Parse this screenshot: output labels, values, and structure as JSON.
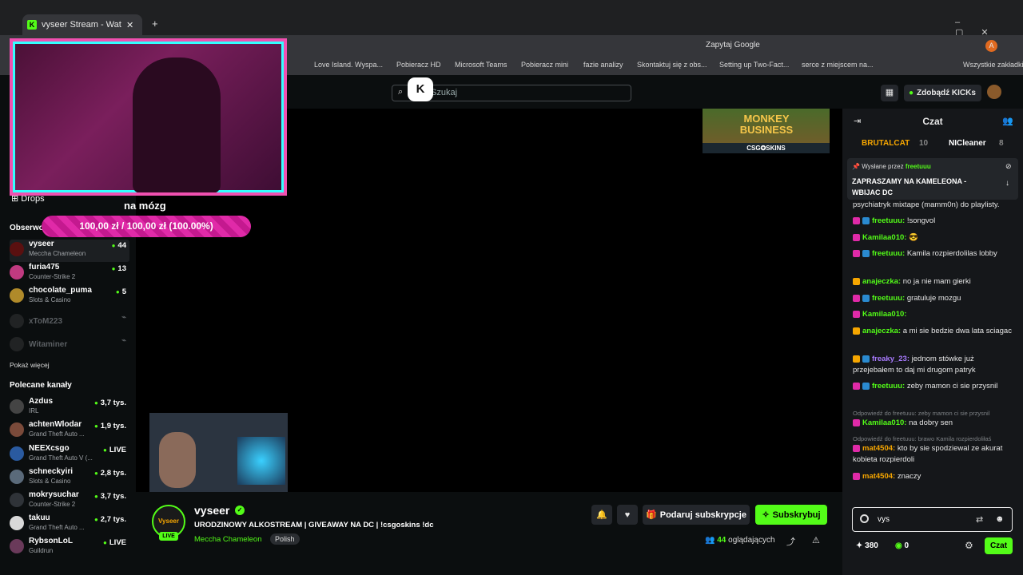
{
  "browser": {
    "tab_title": "vyseer Stream - Watch Live",
    "ask_google": "Zapytaj Google",
    "bookmarks": [
      "Love Island. Wyspa...",
      "Pobieracz HD",
      "Microsoft Teams",
      "Pobieracz mini",
      "fazie analizy",
      "Skontaktuj się z obs...",
      "Setting up Two-Fact...",
      "serce z miejscem na...",
      "Wszystkie zakładki"
    ]
  },
  "header": {
    "search_placeholder": "Szukaj",
    "get_kicks": "Zdobądź KICKs",
    "logo": "K"
  },
  "sidebar": {
    "drops_label": "Drops",
    "followed_title": "Obserwowane",
    "followed": [
      {
        "name": "vyseer",
        "category": "Meccha Chameleon",
        "count": "44"
      },
      {
        "name": "furia475",
        "category": "Counter-Strike 2",
        "count": "13"
      },
      {
        "name": "chocolate_puma",
        "category": "Slots & Casino",
        "count": "5"
      },
      {
        "name": "xToM223",
        "category": "",
        "count": ""
      },
      {
        "name": "Witaminer",
        "category": "",
        "count": ""
      }
    ],
    "show_more": "Pokaż więcej",
    "recommended_title": "Polecane kanały",
    "recommended": [
      {
        "name": "Azdus",
        "category": "IRL",
        "count": "3,7 tys."
      },
      {
        "name": "achtenWlodar",
        "category": "Grand Theft Auto ...",
        "count": "1,9 tys."
      },
      {
        "name": "NEEXcsgo",
        "category": "Grand Theft Auto V (...",
        "count": "LIVE"
      },
      {
        "name": "schneckyiri",
        "category": "Slots & Casino",
        "count": "2,8 tys."
      },
      {
        "name": "mokrysuchar",
        "category": "Counter-Strike 2",
        "count": "3,7 tys."
      },
      {
        "name": "takuu",
        "category": "Grand Theft Auto ...",
        "count": "2,7 tys."
      },
      {
        "name": "RybsonLoL",
        "category": "Guildrun",
        "count": "LIVE"
      }
    ]
  },
  "stream": {
    "donation_text": "na mózg",
    "donation_progress": "100,00 zł / 100,00 zł (100.00%)",
    "donation_fraction": 1.0,
    "ad_title": "MONKEY BUSINESS",
    "ad_sponsor": "CSG✪SKINS"
  },
  "streamer": {
    "name": "vyseer",
    "avatar_text": "Vyseer",
    "live_badge": "LIVE",
    "title": "URODZINOWY ALKOSTREAM | GIVEAWAY NA DC | !csgoskins !dc",
    "category": "Meccha Chameleon",
    "language": "Polish",
    "gift_button": "Podaruj subskrypcje",
    "subscribe_button": "Subskrybuj",
    "viewers_count": "44",
    "viewers_label": "oglądających"
  },
  "chat": {
    "title": "Czat",
    "leaders": [
      {
        "name": "BRUTALCAT",
        "count": "10"
      },
      {
        "name": "NICleaner",
        "count": "8"
      }
    ],
    "pinned_by_label": "Wysłane przez",
    "pinned_by_user": "freetuuu",
    "pinned_message": "ZAPRASZAMY NA KAMELEONA - WBIJAC DC",
    "messages": [
      {
        "user": "",
        "text": "psychiatryk mixtape (mamm0n) do playlisty.",
        "color": "#e6e6e6"
      },
      {
        "user": "freetuuu:",
        "text": "!songvol",
        "color": "#53fc18"
      },
      {
        "user": "Kamilaa010:",
        "text": "😎",
        "color": "#53fc18"
      },
      {
        "user": "freetuuu:",
        "text": "Kamila rozpierdolilas lobby",
        "color": "#53fc18"
      },
      {
        "user": "anajeczka:",
        "text": "no ja nie mam gierki",
        "color": "#53fc18"
      },
      {
        "user": "freetuuu:",
        "text": "gratuluje mozgu",
        "color": "#53fc18"
      },
      {
        "user": "Kamilaa010:",
        "text": "",
        "color": "#53fc18"
      },
      {
        "user": "anajeczka:",
        "text": "a mi sie bedzie dwa lata sciagac",
        "color": "#53fc18"
      },
      {
        "user": "freaky_23:",
        "text": "jednom stówke już przejebałem to daj mi drugom patryk",
        "color": "#a97bff"
      },
      {
        "user": "freetuuu:",
        "text": "zeby mamon ci sie przysnil",
        "color": "#53fc18"
      },
      {
        "user": "Kamilaa010:",
        "text": "na dobry sen",
        "color": "#53fc18"
      },
      {
        "user": "mat4504:",
        "text": "kto by sie spodziewal ze akurat kobieta rozpierdoli",
        "color": "#f6a600"
      },
      {
        "user": "mat4504:",
        "text": "znaczy",
        "color": "#f6a600"
      }
    ],
    "replies": [
      "Odpowiedź do freetuuu: zeby mamon ci sie przysnil",
      "Odpowiedź do freetuuu: brawo Kamila rozpierdoliłaś"
    ],
    "input_value": "vys",
    "points": "380",
    "kicks": "0",
    "send_button": "Czat"
  }
}
